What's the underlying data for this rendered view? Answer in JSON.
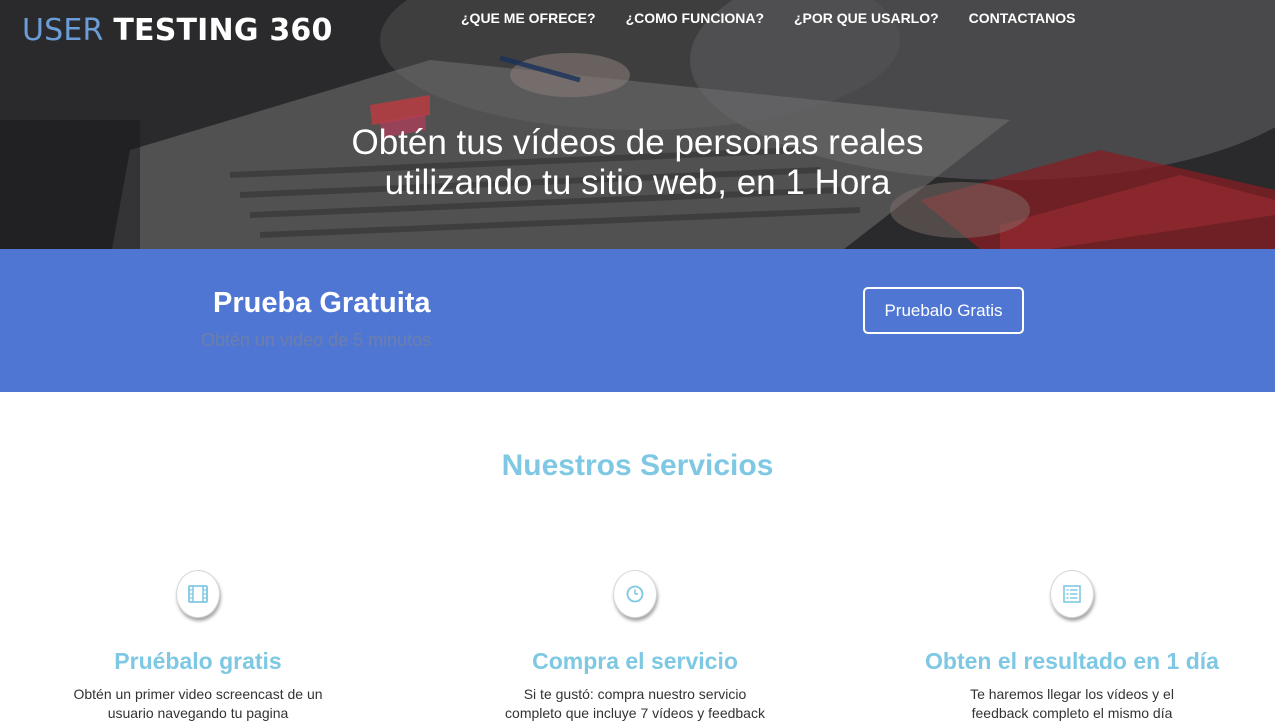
{
  "brand": {
    "part1": "USER",
    "part2": "TESTING 360",
    "accent_color": "#6b9ed8"
  },
  "nav": [
    {
      "label": "¿QUE ME OFRECE?"
    },
    {
      "label": "¿COMO FUNCIONA?"
    },
    {
      "label": "¿POR QUE USARLO?"
    },
    {
      "label": "CONTACTANOS"
    }
  ],
  "hero": {
    "title_line1": "Obtén tus vídeos de personas reales",
    "title_line2": "utilizando tu sitio web, en 1 Hora"
  },
  "cta": {
    "title": "Prueba Gratuita",
    "subtitle": "Obtén un video de 5 minutos",
    "button_label": "Pruebalo Gratis",
    "band_color": "#5076d3"
  },
  "services": {
    "title": "Nuestros Servicios",
    "heading_color": "#7ec8e3",
    "items": [
      {
        "icon": "film-icon",
        "title": "Pruébalo gratis",
        "description": "Obtén un primer video screencast de un usuario navegando tu pagina"
      },
      {
        "icon": "clock-icon",
        "title": "Compra el servicio",
        "description": "Si te gustó: compra nuestro servicio completo que incluye 7 vídeos y feedback"
      },
      {
        "icon": "list-icon",
        "title": "Obten el resultado en 1 día",
        "description": "Te haremos llegar los vídeos y el feedback completo el mismo día"
      }
    ]
  }
}
